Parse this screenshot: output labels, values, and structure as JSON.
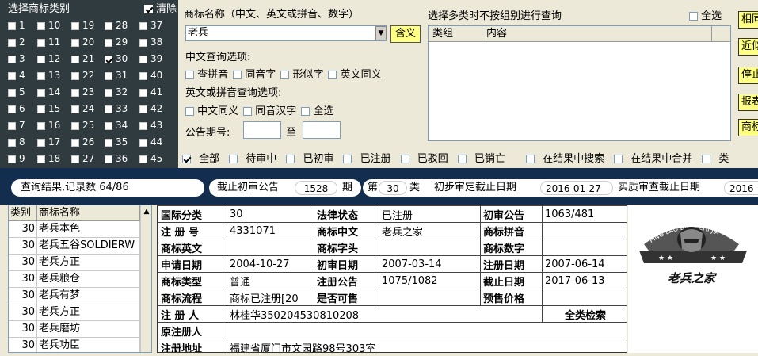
{
  "class_panel": {
    "title": "选择商标类别",
    "clear_label": "清除",
    "columns": [
      [
        {
          "n": "1",
          "c": false
        },
        {
          "n": "2",
          "c": false
        },
        {
          "n": "3",
          "c": false
        },
        {
          "n": "4",
          "c": false
        },
        {
          "n": "5",
          "c": false
        },
        {
          "n": "6",
          "c": false
        },
        {
          "n": "7",
          "c": false
        },
        {
          "n": "8",
          "c": false
        },
        {
          "n": "9",
          "c": false
        }
      ],
      [
        {
          "n": "10",
          "c": false
        },
        {
          "n": "11",
          "c": false
        },
        {
          "n": "12",
          "c": false
        },
        {
          "n": "13",
          "c": false
        },
        {
          "n": "14",
          "c": false
        },
        {
          "n": "15",
          "c": false
        },
        {
          "n": "16",
          "c": false
        },
        {
          "n": "17",
          "c": false
        },
        {
          "n": "18",
          "c": false
        }
      ],
      [
        {
          "n": "19",
          "c": false
        },
        {
          "n": "20",
          "c": false
        },
        {
          "n": "21",
          "c": false
        },
        {
          "n": "22",
          "c": false
        },
        {
          "n": "23",
          "c": false
        },
        {
          "n": "24",
          "c": false
        },
        {
          "n": "25",
          "c": false
        },
        {
          "n": "26",
          "c": false
        },
        {
          "n": "27",
          "c": false
        }
      ],
      [
        {
          "n": "28",
          "c": false
        },
        {
          "n": "29",
          "c": false
        },
        {
          "n": "30",
          "c": true
        },
        {
          "n": "31",
          "c": false
        },
        {
          "n": "32",
          "c": false
        },
        {
          "n": "33",
          "c": false
        },
        {
          "n": "34",
          "c": false
        },
        {
          "n": "35",
          "c": false
        },
        {
          "n": "36",
          "c": false
        }
      ],
      [
        {
          "n": "37",
          "c": false
        },
        {
          "n": "38",
          "c": false
        },
        {
          "n": "39",
          "c": false
        },
        {
          "n": "40",
          "c": false
        },
        {
          "n": "41",
          "c": false
        },
        {
          "n": "42",
          "c": false
        },
        {
          "n": "43",
          "c": false
        },
        {
          "n": "44",
          "c": false
        },
        {
          "n": "45",
          "c": false
        }
      ]
    ]
  },
  "query": {
    "name_label": "商标名称（中文、英文或拼音、数字）",
    "name_value": "老兵",
    "meaning_btn": "含义",
    "cn_options_label": "中文查询选项:",
    "cn_options": [
      "查拼音",
      "同音字",
      "形似字",
      "英文同义"
    ],
    "en_options_label": "英文或拼音查询选项:",
    "en_options": [
      "中文同义",
      "同音汉字",
      "全选"
    ],
    "period_label": "公告期号:",
    "period_to": "至"
  },
  "multi": {
    "label": "选择多类时不按组别进行查询",
    "select_all": "全选",
    "col_group": "类组",
    "col_content": "内容"
  },
  "right_buttons": [
    "相同",
    "近似",
    "停止",
    "报表",
    "商标"
  ],
  "filters": [
    "全部",
    "待审中",
    "已初审",
    "已注册",
    "已驳回",
    "已销亡",
    "在结果中搜索",
    "在结果中合并",
    "类"
  ],
  "result_bar": {
    "result_text": "查询结果,记录数 64/86",
    "deadline_label": "截止初审公告",
    "deadline_value": "1528",
    "deadline_unit": "期",
    "class_prefix": "第",
    "class_value": "30",
    "class_suffix": "类",
    "prelim_label": "初步审定截止日期",
    "prelim_value": "2016-01-27",
    "substantive_label": "实质审查截止日期",
    "substantive_value": "2016-"
  },
  "list": {
    "col_class": "类别",
    "col_name": "商标名称",
    "rows": [
      {
        "class": "30",
        "name": "老兵本色"
      },
      {
        "class": "30",
        "name": "老兵五谷SOLDIERW"
      },
      {
        "class": "30",
        "name": "老兵方正"
      },
      {
        "class": "30",
        "name": "老兵粮仓"
      },
      {
        "class": "30",
        "name": "老兵有梦"
      },
      {
        "class": "30",
        "name": "老兵方正"
      },
      {
        "class": "30",
        "name": "老兵磨坊"
      },
      {
        "class": "30",
        "name": "老兵功臣"
      }
    ]
  },
  "detail": {
    "intl_class_k": "国际分类",
    "intl_class_v": "30",
    "legal_status_k": "法律状态",
    "legal_status_v": "已注册",
    "prelim_pub_k": "初审公告",
    "prelim_pub_v": "1063/481",
    "reg_no_k": "注 册 号",
    "reg_no_v": "4331071",
    "cn_name_k": "商标中文",
    "cn_name_v": "老兵之家",
    "pinyin_k": "商标拼音",
    "pinyin_v": "",
    "en_name_k": "商标英文",
    "en_name_v": "",
    "initial_k": "商标字头",
    "initial_v": "",
    "digit_k": "商标数字",
    "digit_v": "",
    "apply_date_k": "申请日期",
    "apply_date_v": "2004-10-27",
    "prelim_date_k": "初审日期",
    "prelim_date_v": "2007-03-14",
    "reg_date_k": "注册日期",
    "reg_date_v": "2007-06-14",
    "type_k": "商标类型",
    "type_v": "普通",
    "reg_pub_k": "注册公告",
    "reg_pub_v": "1075/1082",
    "expire_k": "截止日期",
    "expire_v": "2017-06-13",
    "flow_k": "商标流程",
    "flow_v": "商标已注册[20",
    "forsale_k": "是否可售",
    "forsale_v": "",
    "presale_k": "预售价格",
    "presale_v": "",
    "registrant_k": "注 册 人",
    "registrant_v": "林桂华350204530810208",
    "allclass_btn": "全类检索",
    "orig_reg_k": "原注册人",
    "orig_reg_v": "",
    "address_k": "注册地址",
    "address_v": "福建省厦门市文园路98号303室"
  },
  "logo": {
    "arc_text": "PING LAO BING ZHI JIA",
    "caption": "老兵之家"
  }
}
